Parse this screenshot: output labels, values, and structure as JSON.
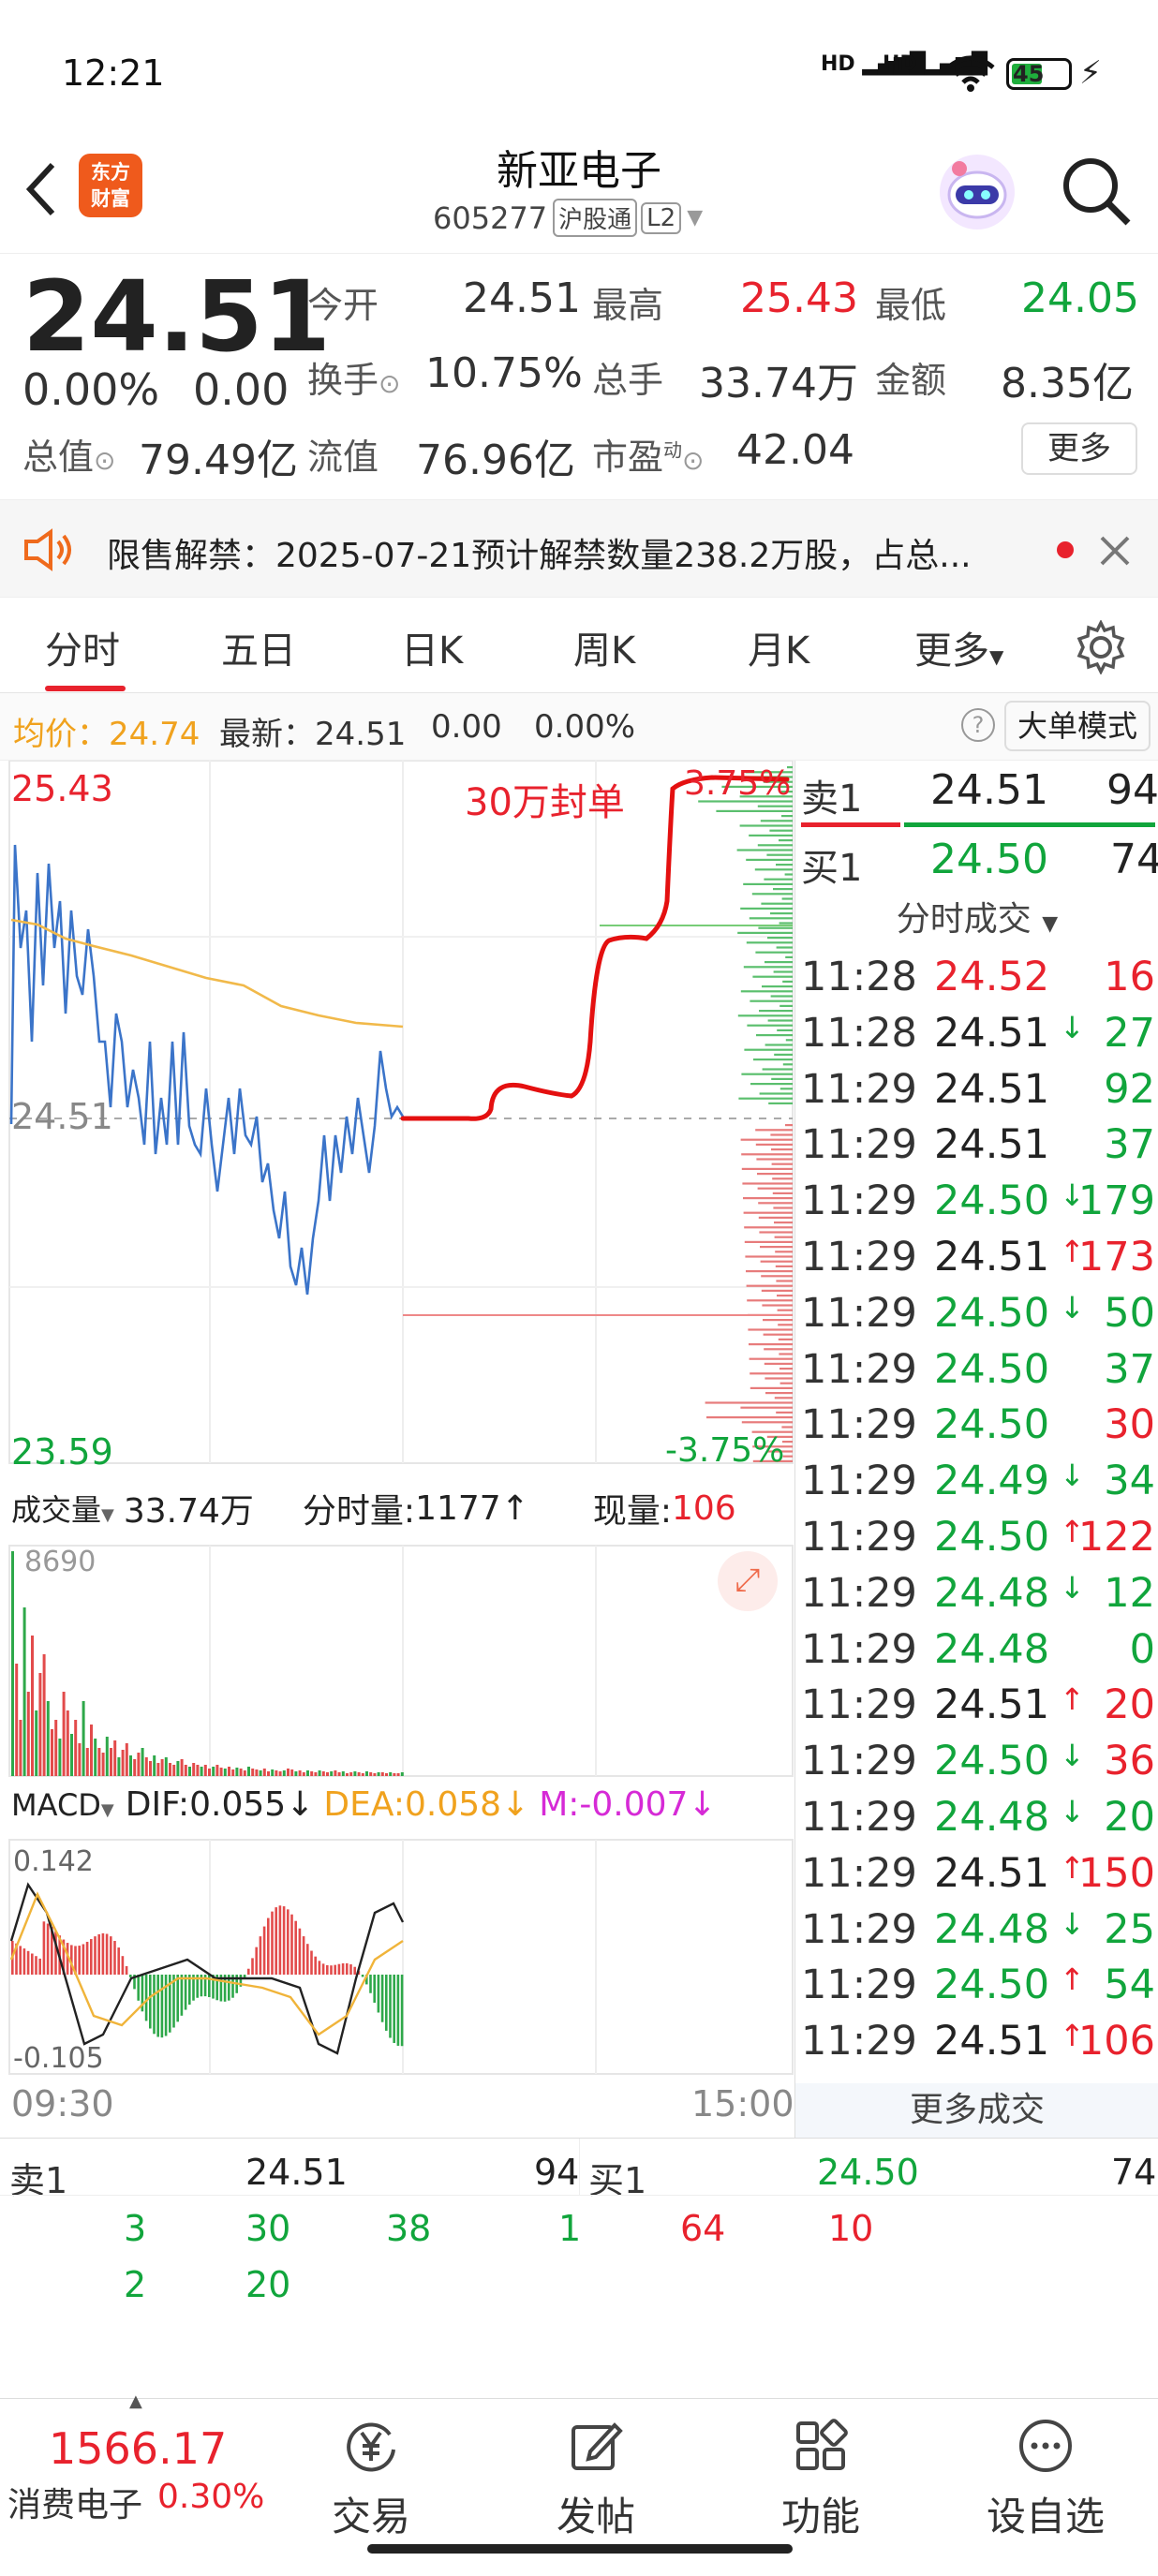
{
  "status": {
    "time": "12:21",
    "network1": "HD",
    "network2": "HD",
    "battery": "45"
  },
  "header": {
    "logo_line1": "东方",
    "logo_line2": "财富",
    "name": "新亚电子",
    "code": "605277",
    "tag1": "沪股通",
    "tag2": "L2"
  },
  "quote": {
    "price": "24.51",
    "change_pct": "0.00%",
    "change": "0.00",
    "open_label": "今开",
    "open": "24.51",
    "high_label": "最高",
    "high": "25.43",
    "low_label": "最低",
    "low": "24.05",
    "turnover_label": "换手",
    "turnover": "10.75%",
    "volume_label": "总手",
    "volume": "33.74万",
    "amount_label": "金额",
    "amount": "8.35亿",
    "mktcap_label": "总值",
    "mktcap": "79.49亿",
    "float_label": "流值",
    "float_cap": "76.96亿",
    "pe_label": "市盈",
    "pe_sup": "动",
    "pe": "42.04",
    "more_btn": "更多"
  },
  "notice": {
    "text": "限售解禁：2025-07-21预计解禁数量238.2万股，占总..."
  },
  "tabs": [
    "分时",
    "五日",
    "日K",
    "周K",
    "月K",
    "更多"
  ],
  "infoline": {
    "avg_label": "均价：",
    "avg": "24.74",
    "latest_label": "最新：",
    "latest": "24.51",
    "chg": "0.00",
    "chg_pct": "0.00%",
    "help": "?",
    "mode_btn": "大单模式"
  },
  "chart": {
    "y_top": "25.43",
    "y_mid": "24.51",
    "y_bottom": "23.59",
    "pct_top": "3.75%",
    "pct_bottom": "-3.75%",
    "annotation": "30万封单",
    "time_start": "09:30",
    "time_end": "15:00"
  },
  "volume_panel": {
    "selector": "成交量",
    "total": "33.74万",
    "min_vol_label": "分时量:",
    "min_vol": "1177",
    "cur_label": "现量:",
    "cur": "106",
    "max": "8690"
  },
  "macd": {
    "selector": "MACD",
    "dif": "DIF:0.055",
    "dea": "DEA:0.058",
    "m": "M:-0.007",
    "top": "0.142",
    "bottom": "-0.105"
  },
  "book": {
    "sell1_label": "卖1",
    "sell1_price": "24.51",
    "sell1_vol": "94",
    "buy1_label": "买1",
    "buy1_price": "24.50",
    "buy1_vol": "74"
  },
  "trades_header": "分时成交",
  "trades": [
    {
      "t": "11:28",
      "p": "24.52",
      "pc": "red",
      "a": "",
      "v": "16",
      "vc": "red"
    },
    {
      "t": "11:28",
      "p": "24.51",
      "pc": "dark",
      "a": "↓",
      "ac": "green",
      "v": "27",
      "vc": "green"
    },
    {
      "t": "11:29",
      "p": "24.51",
      "pc": "dark",
      "a": "",
      "v": "92",
      "vc": "green"
    },
    {
      "t": "11:29",
      "p": "24.51",
      "pc": "dark",
      "a": "",
      "v": "37",
      "vc": "green"
    },
    {
      "t": "11:29",
      "p": "24.50",
      "pc": "green",
      "a": "↓",
      "ac": "green",
      "v": "179",
      "vc": "green"
    },
    {
      "t": "11:29",
      "p": "24.51",
      "pc": "dark",
      "a": "↑",
      "ac": "red",
      "v": "173",
      "vc": "red"
    },
    {
      "t": "11:29",
      "p": "24.50",
      "pc": "green",
      "a": "↓",
      "ac": "green",
      "v": "50",
      "vc": "green"
    },
    {
      "t": "11:29",
      "p": "24.50",
      "pc": "green",
      "a": "",
      "v": "37",
      "vc": "green"
    },
    {
      "t": "11:29",
      "p": "24.50",
      "pc": "green",
      "a": "",
      "v": "30",
      "vc": "red"
    },
    {
      "t": "11:29",
      "p": "24.49",
      "pc": "green",
      "a": "↓",
      "ac": "green",
      "v": "34",
      "vc": "green"
    },
    {
      "t": "11:29",
      "p": "24.50",
      "pc": "green",
      "a": "↑",
      "ac": "red",
      "v": "122",
      "vc": "red"
    },
    {
      "t": "11:29",
      "p": "24.48",
      "pc": "green",
      "a": "↓",
      "ac": "green",
      "v": "12",
      "vc": "green"
    },
    {
      "t": "11:29",
      "p": "24.48",
      "pc": "green",
      "a": "",
      "v": "0",
      "vc": "green"
    },
    {
      "t": "11:29",
      "p": "24.51",
      "pc": "dark",
      "a": "↑",
      "ac": "red",
      "v": "20",
      "vc": "red"
    },
    {
      "t": "11:29",
      "p": "24.50",
      "pc": "green",
      "a": "↓",
      "ac": "green",
      "v": "36",
      "vc": "red"
    },
    {
      "t": "11:29",
      "p": "24.48",
      "pc": "green",
      "a": "↓",
      "ac": "green",
      "v": "20",
      "vc": "green"
    },
    {
      "t": "11:29",
      "p": "24.51",
      "pc": "dark",
      "a": "↑",
      "ac": "red",
      "v": "150",
      "vc": "red"
    },
    {
      "t": "11:29",
      "p": "24.48",
      "pc": "green",
      "a": "↓",
      "ac": "green",
      "v": "25",
      "vc": "green"
    },
    {
      "t": "11:29",
      "p": "24.50",
      "pc": "green",
      "a": "↑",
      "ac": "red",
      "v": "54",
      "vc": "green"
    },
    {
      "t": "11:29",
      "p": "24.51",
      "pc": "dark",
      "a": "↑",
      "ac": "red",
      "v": "106",
      "vc": "red"
    }
  ],
  "more_trades": "更多成交",
  "bottom_book": {
    "sell_label": "卖1",
    "sell_price": "24.51",
    "sell_vol": "94",
    "buy_label": "买1",
    "buy_price": "24.50",
    "buy_vol": "74",
    "sell_q1": [
      "3",
      "30",
      "38",
      "1"
    ],
    "sell_q2": [
      "2",
      "20"
    ],
    "buy_q1": [
      "64",
      "10"
    ]
  },
  "bottom_nav": {
    "index_value": "1566.17",
    "index_name": "消费电子",
    "index_pct": "0.30%",
    "trade": "交易",
    "post": "发帖",
    "func": "功能",
    "watch": "设自选"
  }
}
